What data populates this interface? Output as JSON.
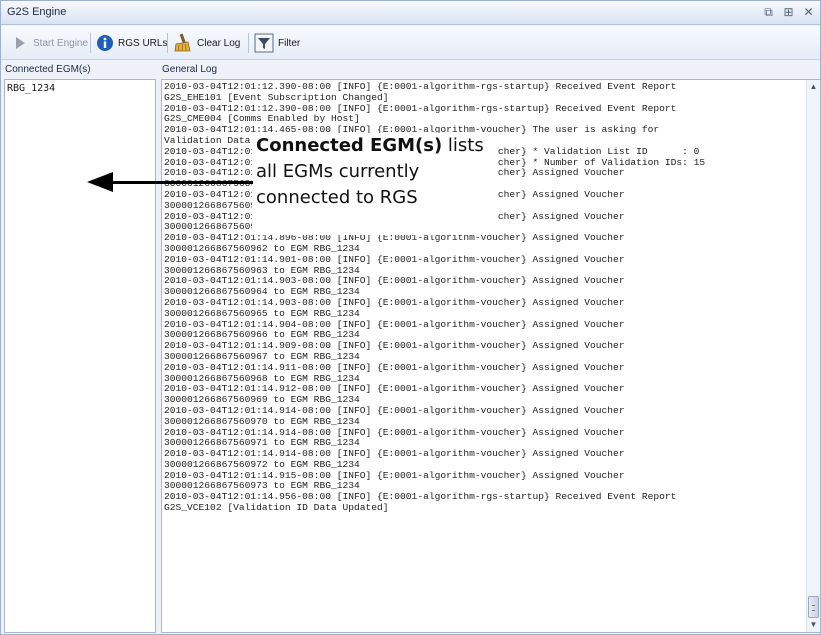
{
  "window": {
    "title": "G2S Engine",
    "controls": {
      "restore": "⧉",
      "pin": "⊞",
      "close": "✕"
    }
  },
  "toolbar": {
    "start_engine": "Start Engine",
    "rgs_urls": "RGS URLs",
    "clear_log": "Clear Log",
    "filter": "Filter"
  },
  "connected_egms": {
    "header": "Connected EGM(s)",
    "items": [
      "RBG_1234"
    ]
  },
  "general_log": {
    "header": "General Log",
    "lines": [
      "2010-03-04T12:01:12.390-08:00 [INFO] {E:0001-algorithm-rgs-startup} Received Event Report",
      "G2S_EHE101 [Event Subscription Changed]",
      "2010-03-04T12:01:12.390-08:00 [INFO] {E:0001-algorithm-rgs-startup} Received Event Report",
      "G2S_CME004 [Comms Enabled by Host]",
      "2010-03-04T12:01:14.465-08:00 [INFO] {E:0001-algorithm-voucher} The user is asking for",
      "Validation Data",
      "2010-03-04T12:01:14.896-08:00 [INFO] {E:0001-algorithm-voucher} * Validation List ID      : 0",
      "2010-03-04T12:01:14.896-08:00 [INFO] {E:0001-algorithm-voucher} * Number of Validation IDs: 15",
      "2010-03-04T12:01:14.896-08:00 [INFO] {E:0001-algorithm-voucher} Assigned Voucher",
      "300001266867560959 to EGM RBG_1234",
      "2010-03-04T12:01:14.896-08:00 [INFO] {E:0001-algorithm-voucher} Assigned Voucher",
      "300001266867560960 to EGM RBG_1234",
      "2010-03-04T12:01:14.896-08:00 [INFO] {E:0001-algorithm-voucher} Assigned Voucher",
      "300001266867560961 to EGM RBG_1234",
      "2010-03-04T12:01:14.896-08:00 [INFO] {E:0001-algorithm-voucher} Assigned Voucher",
      "300001266867560962 to EGM RBG_1234",
      "2010-03-04T12:01:14.901-08:00 [INFO] {E:0001-algorithm-voucher} Assigned Voucher",
      "300001266867560963 to EGM RBG_1234",
      "2010-03-04T12:01:14.903-08:00 [INFO] {E:0001-algorithm-voucher} Assigned Voucher",
      "300001266867560964 to EGM RBG_1234",
      "2010-03-04T12:01:14.903-08:00 [INFO] {E:0001-algorithm-voucher} Assigned Voucher",
      "300001266867560965 to EGM RBG_1234",
      "2010-03-04T12:01:14.904-08:00 [INFO] {E:0001-algorithm-voucher} Assigned Voucher",
      "300001266867560966 to EGM RBG_1234",
      "2010-03-04T12:01:14.909-08:00 [INFO] {E:0001-algorithm-voucher} Assigned Voucher",
      "300001266867560967 to EGM RBG_1234",
      "2010-03-04T12:01:14.911-08:00 [INFO] {E:0001-algorithm-voucher} Assigned Voucher",
      "300001266867560968 to EGM RBG_1234",
      "2010-03-04T12:01:14.912-08:00 [INFO] {E:0001-algorithm-voucher} Assigned Voucher",
      "300001266867560969 to EGM RBG_1234",
      "2010-03-04T12:01:14.914-08:00 [INFO] {E:0001-algorithm-voucher} Assigned Voucher",
      "300001266867560970 to EGM RBG_1234",
      "2010-03-04T12:01:14.914-08:00 [INFO] {E:0001-algorithm-voucher} Assigned Voucher",
      "300001266867560971 to EGM RBG_1234",
      "2010-03-04T12:01:14.914-08:00 [INFO] {E:0001-algorithm-voucher} Assigned Voucher",
      "300001266867560972 to EGM RBG_1234",
      "2010-03-04T12:01:14.915-08:00 [INFO] {E:0001-algorithm-voucher} Assigned Voucher",
      "300001266867560973 to EGM RBG_1234",
      "2010-03-04T12:01:14.956-08:00 [INFO] {E:0001-algorithm-rgs-startup} Received Event Report",
      "G2S_VCE102 [Validation ID Data Updated]"
    ]
  },
  "annotation": {
    "bold": "Connected EGM(s)",
    "rest_line1": " lists",
    "line2": "all EGMs currently",
    "line3": "connected to RGS"
  },
  "icons": {
    "start_engine": "play-icon",
    "rgs_urls": "info-icon",
    "clear_log": "broom-icon",
    "filter": "filter-icon"
  }
}
